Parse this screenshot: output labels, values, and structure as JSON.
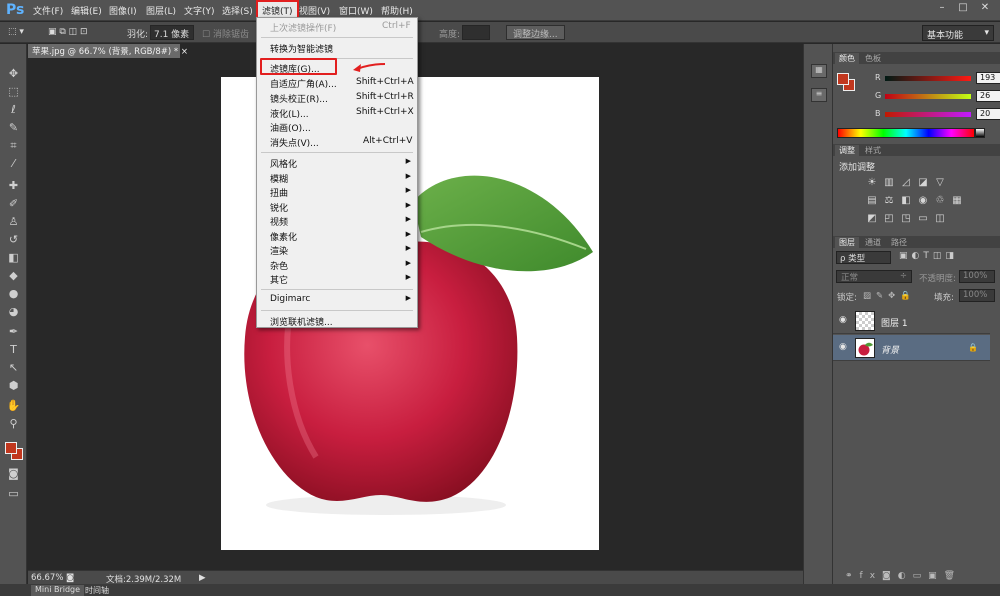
{
  "menubar": {
    "logo": "Ps",
    "items": [
      "文件(F)",
      "编辑(E)",
      "图像(I)",
      "图层(L)",
      "文字(Y)",
      "选择(S)",
      "滤镜(T)",
      "视图(V)",
      "窗口(W)",
      "帮助(H)"
    ],
    "active_item": "滤镜(T)"
  },
  "options": {
    "feather_label": "羽化:",
    "feather_value": "7.1 像素",
    "antialias_label": "消除锯齿",
    "height_label": "高度:",
    "refine_edge": "调整边缘...",
    "workspace": "基本功能"
  },
  "document": {
    "tab_title": "苹果.jpg @ 66.7% (背景, RGB/8#) *",
    "zoom": "66.67%",
    "doc_info": "文档:2.39M/2.32M"
  },
  "bottom_tabs": [
    "Mini Bridge",
    "时间轴"
  ],
  "filter_menu": {
    "last_filter": "上次滤镜操作(F)",
    "last_filter_shortcut": "Ctrl+F",
    "smart_filter": "转换为智能滤镜",
    "filter_gallery": "滤镜库(G)...",
    "adaptive_wide": "自适应广角(A)...",
    "adaptive_wide_shortcut": "Shift+Ctrl+A",
    "lens_correction": "镜头校正(R)...",
    "lens_correction_shortcut": "Shift+Ctrl+R",
    "liquify": "液化(L)...",
    "liquify_shortcut": "Shift+Ctrl+X",
    "oil_paint": "油画(O)...",
    "vanishing_point": "消失点(V)...",
    "vanishing_point_shortcut": "Alt+Ctrl+V",
    "submenus": [
      "风格化",
      "模糊",
      "扭曲",
      "锐化",
      "视频",
      "像素化",
      "渲染",
      "杂色",
      "其它"
    ],
    "digimarc": "Digimarc",
    "browse_online": "浏览联机滤镜..."
  },
  "color_panel": {
    "tabs": [
      "颜色",
      "色板"
    ],
    "r_label": "R",
    "r_value": "193",
    "g_label": "G",
    "g_value": "26",
    "b_label": "B",
    "b_value": "20",
    "foreground": "#c1371e"
  },
  "adjust_panel": {
    "tabs": [
      "调整",
      "样式"
    ],
    "title": "添加调整"
  },
  "layers_panel": {
    "tabs": [
      "图层",
      "通道",
      "路径"
    ],
    "kind_label": "ρ 类型",
    "blend_mode": "正常",
    "opacity_label": "不透明度:",
    "opacity_value": "100%",
    "lock_label": "锁定:",
    "fill_label": "填充:",
    "fill_value": "100%",
    "layers": [
      {
        "name": "图层 1",
        "selected": false
      },
      {
        "name": "背景",
        "selected": true
      }
    ]
  }
}
